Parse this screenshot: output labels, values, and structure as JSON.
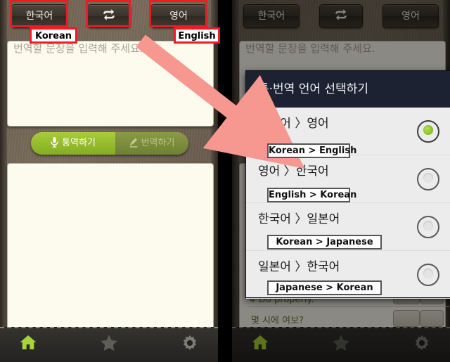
{
  "app": {
    "left_panel_name": "translator-main-screen",
    "right_panel_name": "translator-language-dialog-screen"
  },
  "topbar": {
    "source_language": "한국어",
    "target_language": "영어",
    "swap_icon": "swap-arrows-icon",
    "swap_label": ""
  },
  "input": {
    "placeholder": "번역할 문장을 입력해 주세요.",
    "value": ""
  },
  "output": {
    "value": ""
  },
  "modes": {
    "interpret": "통역하기",
    "translate": "번역하기",
    "interpret_icon": "microphone-icon",
    "translate_icon": "pen-icon"
  },
  "nav": {
    "home": "home-icon",
    "favorites": "star-icon",
    "settings": "gear-icon"
  },
  "dialog": {
    "title": "통·번역 언어 선택하기",
    "items": [
      {
        "label": "한국어 〉영어",
        "english": "Korean > English",
        "selected": true
      },
      {
        "label": "영어 〉한국어",
        "english": "English > Korean",
        "selected": false
      },
      {
        "label": "한국어 〉일본어",
        "english": "Korean > Japanese",
        "selected": false
      },
      {
        "label": "일본어 〉한국어",
        "english": "Japanese > Korean",
        "selected": false
      }
    ]
  },
  "results": [
    {
      "arrow": "↳",
      "text": "Do properly."
    },
    {
      "arrow": "",
      "text": "몇 시에 여보?"
    }
  ],
  "annotations": {
    "source_label": "Korean",
    "target_label": "English",
    "arrow_color": "#f79890",
    "box_color": "#ec1c24"
  }
}
